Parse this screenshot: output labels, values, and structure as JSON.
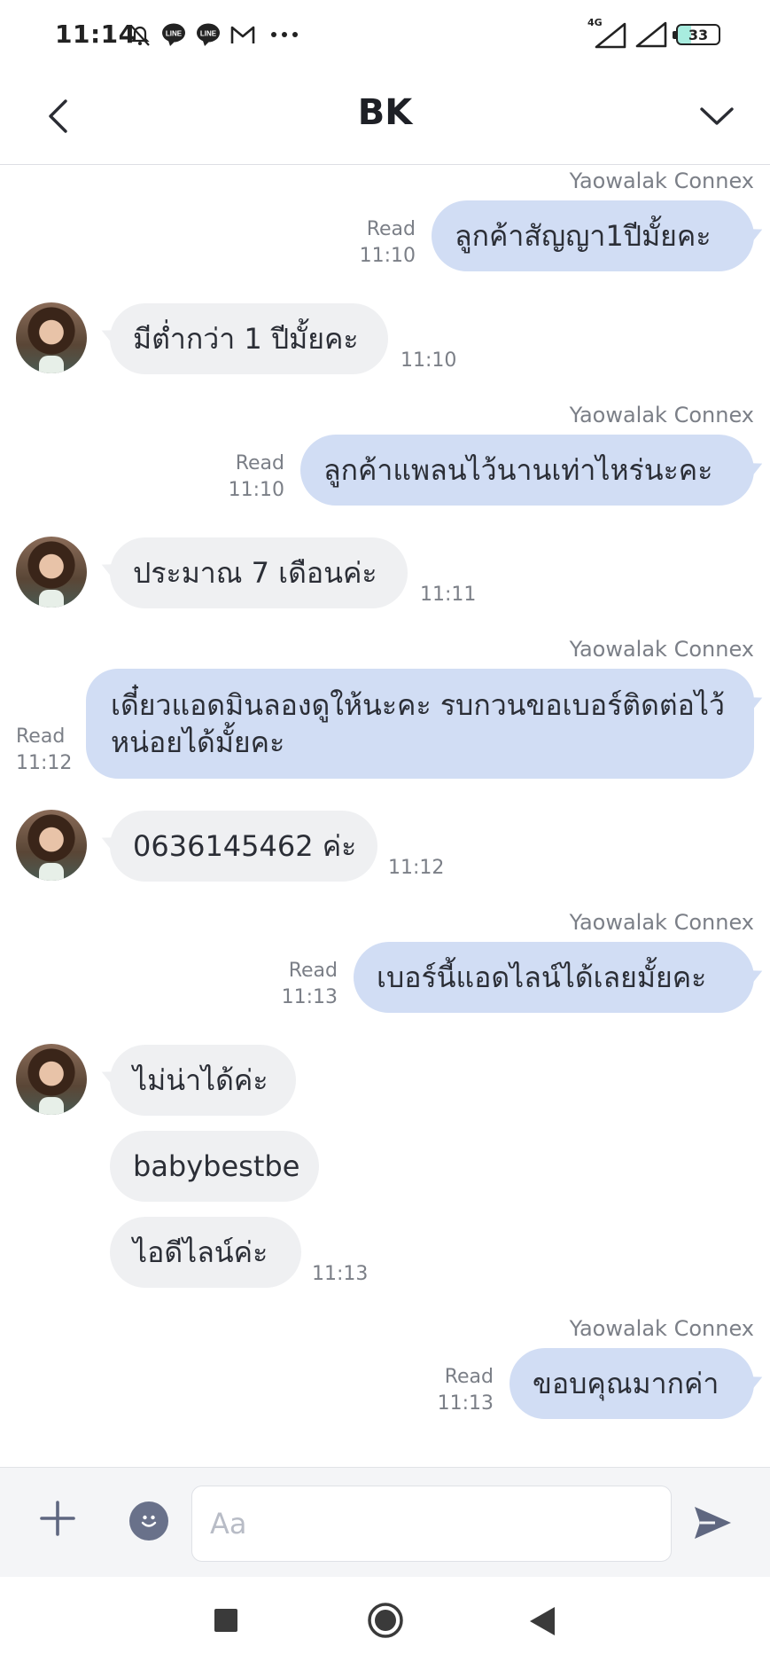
{
  "status_bar": {
    "time": "11:14",
    "network": "4G",
    "battery": "33",
    "icons": [
      "mute-bell-icon",
      "line-icon",
      "line-icon",
      "gmail-icon",
      "more-dots-icon",
      "signal-icon",
      "signal-icon",
      "battery-icon"
    ]
  },
  "header": {
    "title": "BK",
    "back_icon": "chevron-left-icon",
    "menu_icon": "chevron-down-icon"
  },
  "messages": {
    "m1": {
      "sender": "Yaowalak Connex",
      "text": "ลูกค้าสัญญา1ปีมั้ยคะ",
      "read": "Read",
      "time": "11:10"
    },
    "m2": {
      "text": "มีต่ำกว่า 1 ปีมั้ยคะ",
      "time": "11:10"
    },
    "m3": {
      "sender": "Yaowalak Connex",
      "text": "ลูกค้าแพลนไว้นานเท่าไหร่นะคะ",
      "read": "Read",
      "time": "11:10"
    },
    "m4": {
      "text": "ประมาณ 7 เดือนค่ะ",
      "time": "11:11"
    },
    "m5": {
      "sender": "Yaowalak Connex",
      "text": "เดี๋ยวแอดมินลองดูให้นะคะ รบกวนขอเบอร์ติดต่อไว้หน่อยได้มั้ยคะ",
      "read": "Read",
      "time": "11:12"
    },
    "m6": {
      "text": "0636145462 ค่ะ",
      "time": "11:12"
    },
    "m7": {
      "sender": "Yaowalak Connex",
      "text": "เบอร์นี้แอดไลน์ได้เลยมั้ยคะ",
      "read": "Read",
      "time": "11:13"
    },
    "m8a": {
      "text": "ไม่น่าได้ค่ะ"
    },
    "m8b": {
      "text": "babybestbe"
    },
    "m8c": {
      "text": "ไอดีไลน์ค่ะ",
      "time": "11:13"
    },
    "m9": {
      "sender": "Yaowalak Connex",
      "text": "ขอบคุณมากค่า",
      "read": "Read",
      "time": "11:13"
    }
  },
  "input_bar": {
    "placeholder": "Aa",
    "value": ""
  },
  "colors": {
    "outgoing_bubble": "#d1ddf4",
    "incoming_bubble": "#eff0f2",
    "meta_text": "#7b7f87"
  }
}
